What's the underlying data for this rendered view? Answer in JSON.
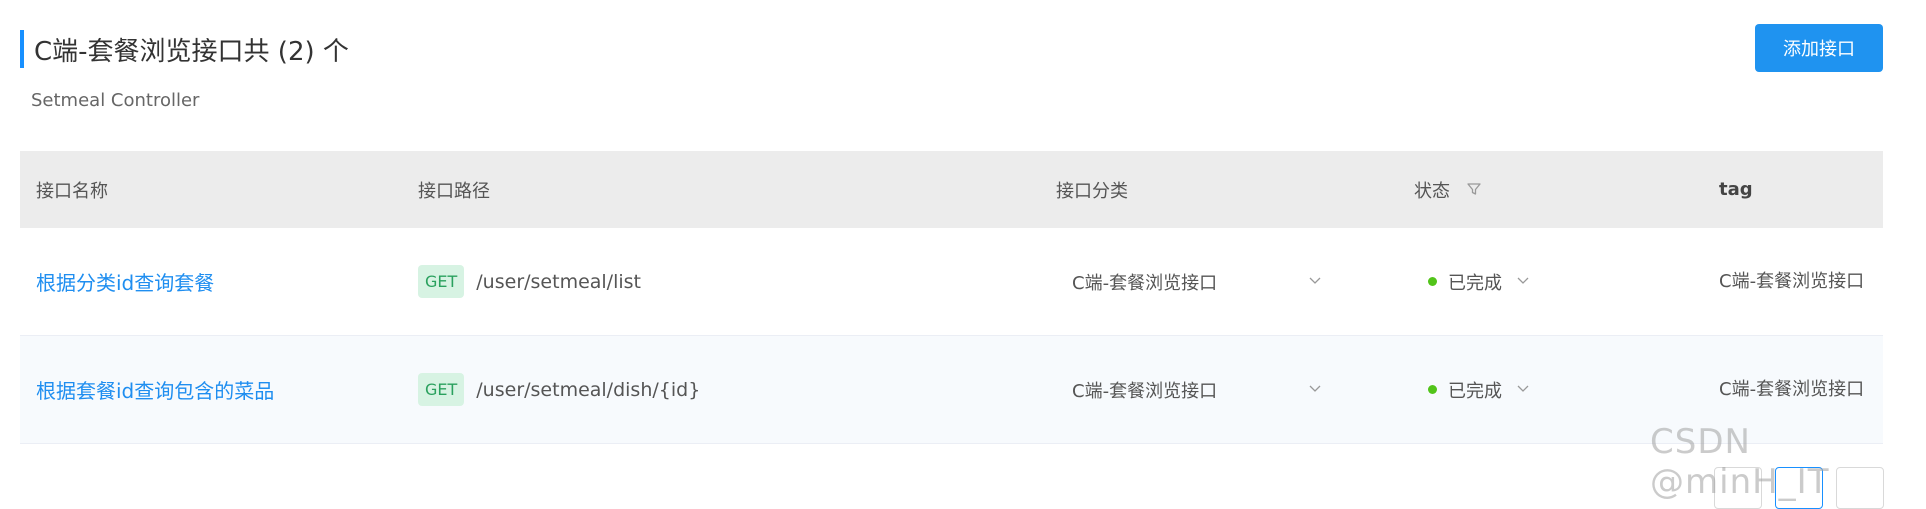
{
  "header": {
    "title": "C端-套餐浏览接口共 (2) 个",
    "subtitle": "Setmeal Controller",
    "add_button": "添加接口"
  },
  "table": {
    "columns": [
      "接口名称",
      "接口路径",
      "接口分类",
      "状态",
      "tag"
    ],
    "rows": [
      {
        "name": "根据分类id查询套餐",
        "method": "GET",
        "path": "/user/setmeal/list",
        "category": "C端-套餐浏览接口",
        "status": "已完成",
        "tag": "C端-套餐浏览接口"
      },
      {
        "name": "根据套餐id查询包含的菜品",
        "method": "GET",
        "path": "/user/setmeal/dish/{id}",
        "category": "C端-套餐浏览接口",
        "status": "已完成",
        "tag": "C端-套餐浏览接口"
      }
    ]
  },
  "watermark": "CSDN @minH_IT",
  "colors": {
    "accent": "#1f93f0",
    "get_bg": "#d7f3e3",
    "get_text": "#2aa15e",
    "status_done": "#52c41a"
  }
}
